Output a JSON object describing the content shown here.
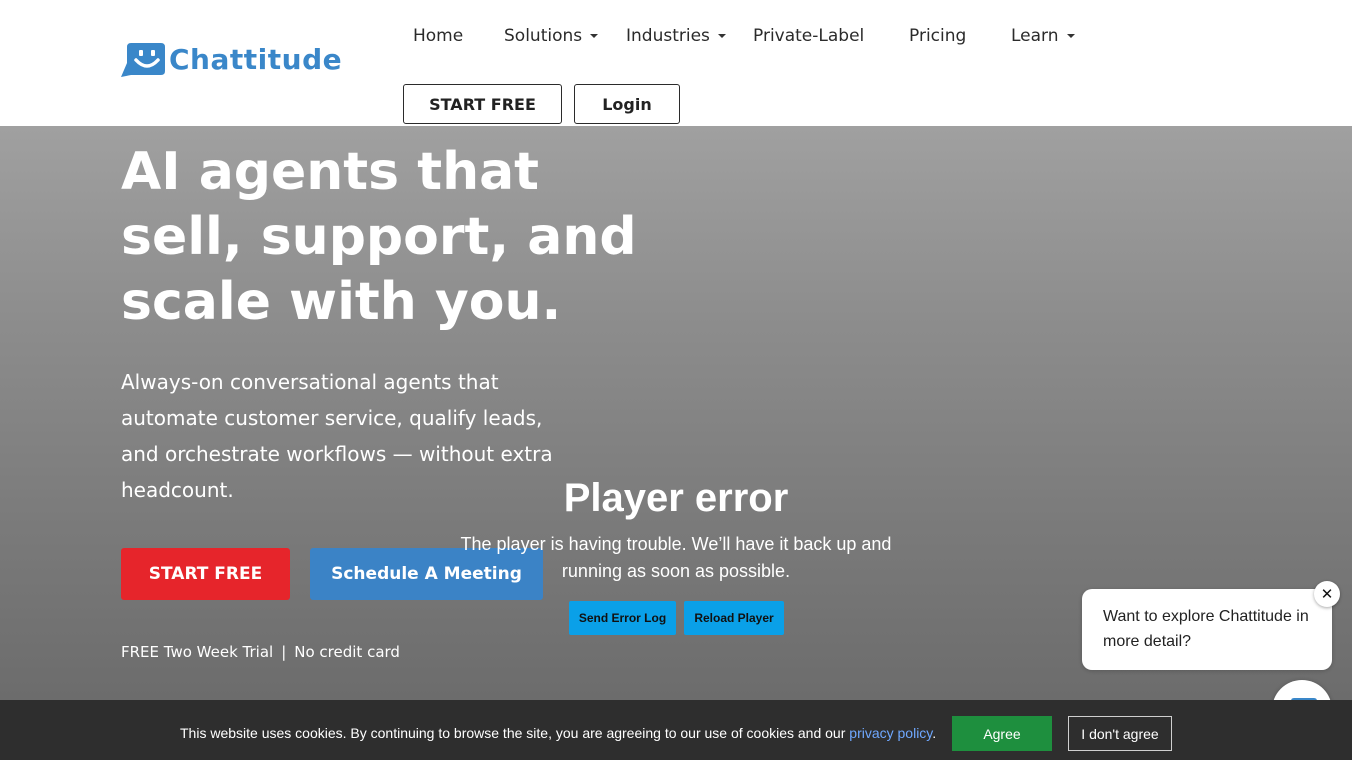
{
  "header": {
    "logo_text": "Chattitude",
    "nav": [
      {
        "label": "Home",
        "has_dropdown": false
      },
      {
        "label": "Solutions",
        "has_dropdown": true
      },
      {
        "label": "Industries",
        "has_dropdown": true
      },
      {
        "label": "Private-Label",
        "has_dropdown": false
      },
      {
        "label": "Pricing",
        "has_dropdown": false
      },
      {
        "label": "Learn",
        "has_dropdown": true
      }
    ],
    "start_free_label": "START FREE",
    "login_label": "Login"
  },
  "hero": {
    "title": "AI agents that sell, support, and scale with you.",
    "subtitle": "Always-on conversational agents that automate customer service, qualify leads, and orchestrate workflows — without extra headcount.",
    "primary_cta": "START FREE",
    "secondary_cta": "Schedule A Meeting",
    "trial_text": "FREE Two Week Trial",
    "separator": "|",
    "no_card_text": "No credit card"
  },
  "player": {
    "title": "Player error",
    "message": "The player is having trouble. We’ll have it back up and running as soon as possible.",
    "send_log_label": "Send Error Log",
    "reload_label": "Reload Player"
  },
  "chat": {
    "prompt": "Want to explore Chattitude in more detail?",
    "close_symbol": "✕"
  },
  "cookie": {
    "text_before": "This website uses cookies. By continuing to browse the site, you are agreeing to our use of cookies and our",
    "link_text": "privacy policy",
    "text_after": ".",
    "agree_label": "Agree",
    "disagree_label": "I don't agree"
  },
  "colors": {
    "brand_blue": "#3a87c9",
    "cta_red": "#e6252b",
    "cta_blue": "#3b83c6",
    "player_button": "#0aa0e8",
    "agree_green": "#1e8f3e",
    "cookie_bar": "#2e2e2e"
  }
}
